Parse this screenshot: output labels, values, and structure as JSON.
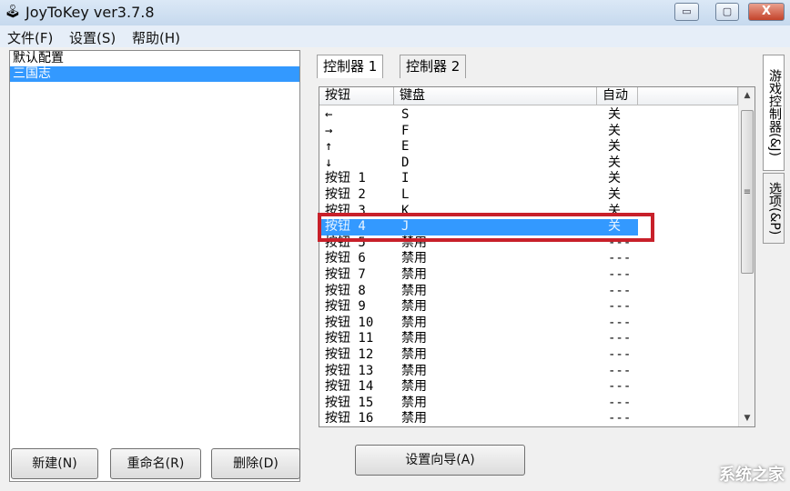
{
  "window": {
    "title": "JoyToKey ver3.7.8",
    "minimize": "▭",
    "maximize": "▢",
    "close": "X"
  },
  "menu": [
    "文件(F)",
    "设置(S)",
    "帮助(H)"
  ],
  "profiles": [
    {
      "label": "默认配置",
      "selected": false
    },
    {
      "label": "三国志",
      "selected": true
    }
  ],
  "buttons": {
    "new": "新建(N)",
    "rename": "重命名(R)",
    "delete": "删除(D)",
    "wizard": "设置向导(A)"
  },
  "tabs": [
    "控制器 1",
    "控制器 2"
  ],
  "side_tabs": [
    "游戏控制器(&J)",
    "选项(&P)"
  ],
  "columns": [
    "按钮",
    "键盘",
    "自动"
  ],
  "rows": [
    {
      "button": "←",
      "key": "S",
      "auto": "关"
    },
    {
      "button": "→",
      "key": "F",
      "auto": "关"
    },
    {
      "button": "↑",
      "key": "E",
      "auto": "关"
    },
    {
      "button": "↓",
      "key": "D",
      "auto": "关"
    },
    {
      "button": "按钮 1",
      "key": "I",
      "auto": "关"
    },
    {
      "button": "按钮 2",
      "key": "L",
      "auto": "关"
    },
    {
      "button": "按钮 3",
      "key": "K",
      "auto": "关"
    },
    {
      "button": "按钮 4",
      "key": "J",
      "auto": "关"
    },
    {
      "button": "按钮 5",
      "key": "禁用",
      "auto": "---"
    },
    {
      "button": "按钮 6",
      "key": "禁用",
      "auto": "---"
    },
    {
      "button": "按钮 7",
      "key": "禁用",
      "auto": "---"
    },
    {
      "button": "按钮 8",
      "key": "禁用",
      "auto": "---"
    },
    {
      "button": "按钮 9",
      "key": "禁用",
      "auto": "---"
    },
    {
      "button": "按钮 10",
      "key": "禁用",
      "auto": "---"
    },
    {
      "button": "按钮 11",
      "key": "禁用",
      "auto": "---"
    },
    {
      "button": "按钮 12",
      "key": "禁用",
      "auto": "---"
    },
    {
      "button": "按钮 13",
      "key": "禁用",
      "auto": "---"
    },
    {
      "button": "按钮 14",
      "key": "禁用",
      "auto": "---"
    },
    {
      "button": "按钮 15",
      "key": "禁用",
      "auto": "---"
    },
    {
      "button": "按钮 16",
      "key": "禁用",
      "auto": "---"
    }
  ],
  "selected_row": 7,
  "watermark": "系统之家"
}
